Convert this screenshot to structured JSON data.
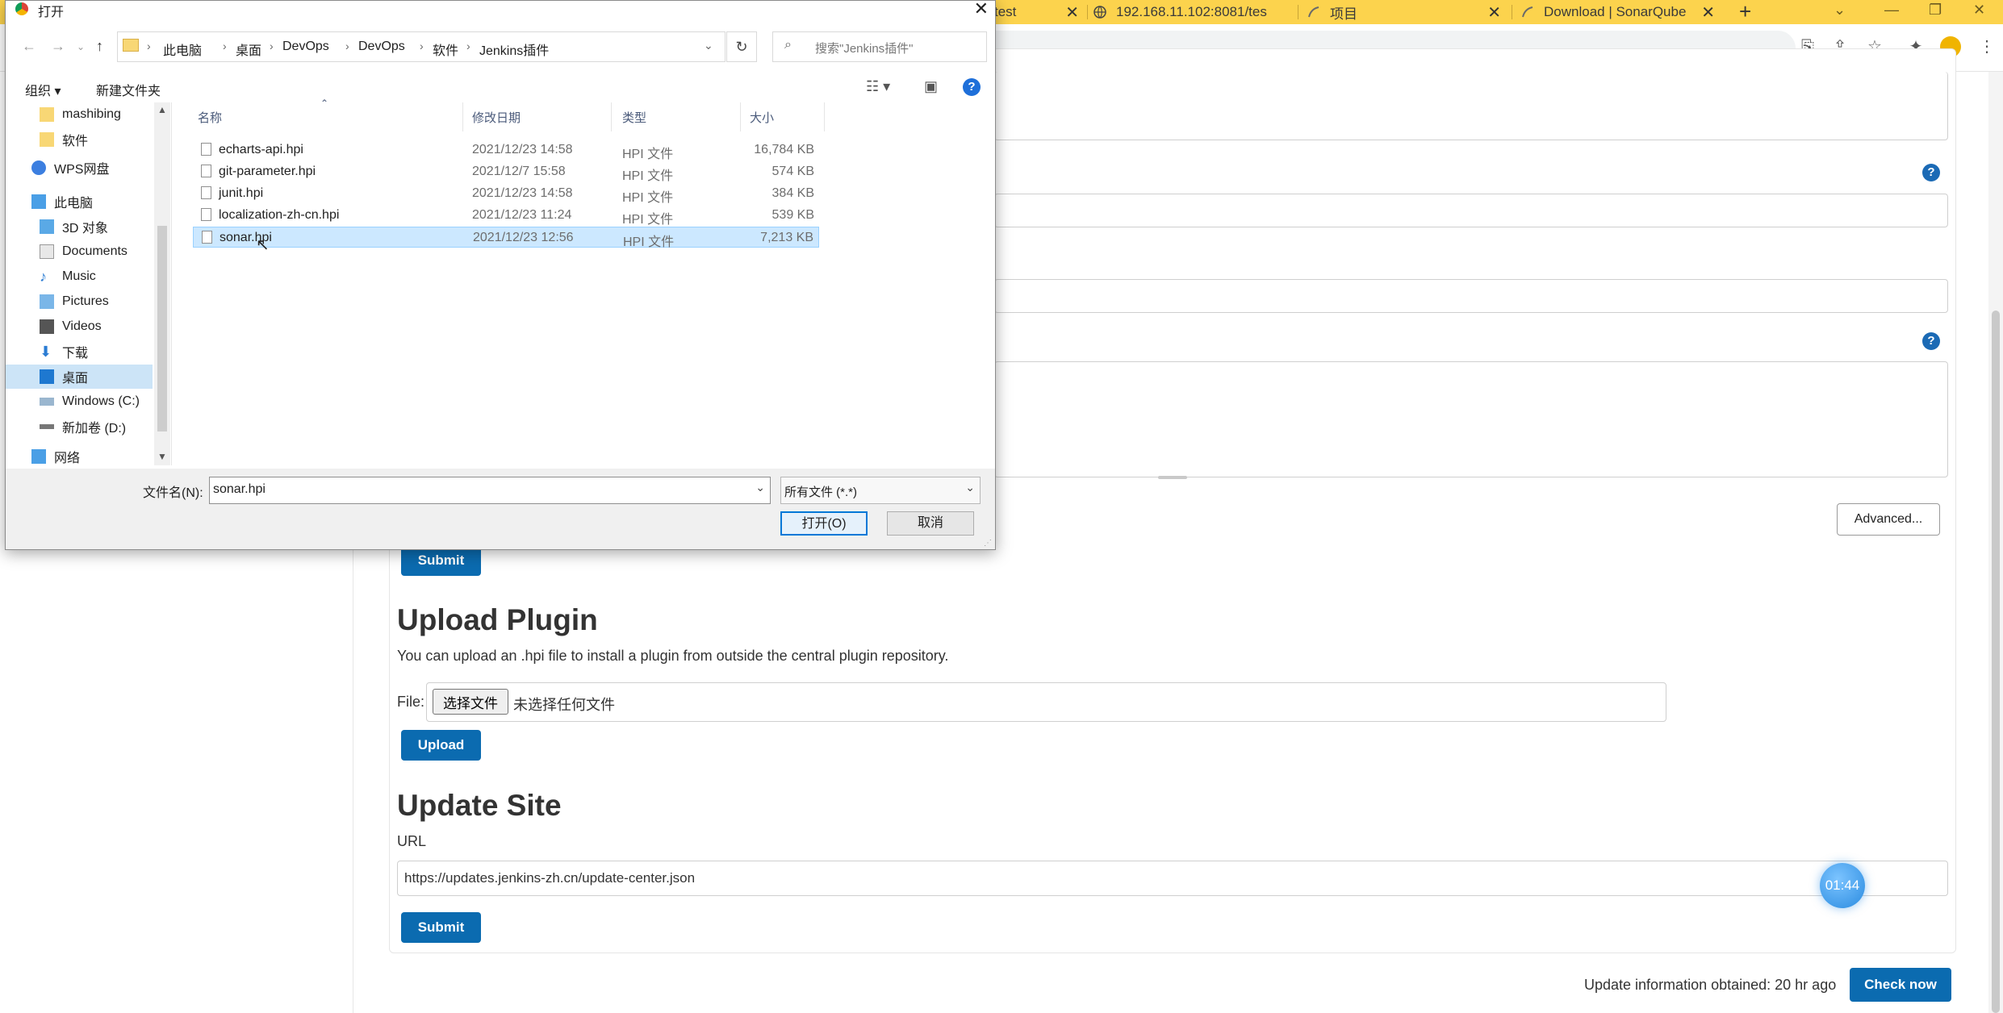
{
  "browser": {
    "tabs": [
      {
        "title": "test"
      },
      {
        "title": "192.168.11.102:8081/tes"
      },
      {
        "title": "项目"
      },
      {
        "title": "Download | SonarQube"
      }
    ],
    "new_tab": "+",
    "colors": {
      "tabstrip": "#fcd34d",
      "accent": "#0b6bb0"
    }
  },
  "page": {
    "advanced_button": "Advanced...",
    "submit_label": "Submit",
    "upload_plugin": {
      "title": "Upload Plugin",
      "description": "You can upload an .hpi file to install a plugin from outside the central plugin repository.",
      "file_label": "File:",
      "choose_button": "选择文件",
      "no_file_text": "未选择任何文件",
      "upload_button": "Upload"
    },
    "update_site": {
      "title": "Update Site",
      "url_label": "URL",
      "url_value": "https://updates.jenkins-zh.cn/update-center.json",
      "submit_button": "Submit"
    },
    "footer": {
      "update_info": "Update information obtained: 20 hr ago",
      "check_now": "Check now"
    },
    "timer": "01:44"
  },
  "dialog": {
    "title": "打开",
    "breadcrumbs": [
      "此电脑",
      "桌面",
      "DevOps",
      "DevOps",
      "软件",
      "Jenkins插件"
    ],
    "search_placeholder": "搜索\"Jenkins插件\"",
    "organize": "组织 ▾",
    "new_folder": "新建文件夹",
    "nav_items": [
      {
        "label": "mashibing",
        "icon": "folder-icon"
      },
      {
        "label": "软件",
        "icon": "folder-icon"
      },
      {
        "label": "WPS网盘",
        "icon": "cloud-icon"
      },
      {
        "label": "此电脑",
        "icon": "computer-icon"
      },
      {
        "label": "3D 对象",
        "icon": "cube-icon"
      },
      {
        "label": "Documents",
        "icon": "document-icon"
      },
      {
        "label": "Music",
        "icon": "music-icon"
      },
      {
        "label": "Pictures",
        "icon": "picture-icon"
      },
      {
        "label": "Videos",
        "icon": "video-icon"
      },
      {
        "label": "下载",
        "icon": "download-icon"
      },
      {
        "label": "桌面",
        "icon": "desktop-icon"
      },
      {
        "label": "Windows (C:)",
        "icon": "drive-icon"
      },
      {
        "label": "新加卷 (D:)",
        "icon": "drive-icon"
      },
      {
        "label": "网络",
        "icon": "network-icon"
      }
    ],
    "columns": [
      "名称",
      "修改日期",
      "类型",
      "大小"
    ],
    "files": [
      {
        "name": "echarts-api.hpi",
        "date": "2021/12/23 14:58",
        "type": "HPI 文件",
        "size": "16,784 KB"
      },
      {
        "name": "git-parameter.hpi",
        "date": "2021/12/7 15:58",
        "type": "HPI 文件",
        "size": "574 KB"
      },
      {
        "name": "junit.hpi",
        "date": "2021/12/23 14:58",
        "type": "HPI 文件",
        "size": "384 KB"
      },
      {
        "name": "localization-zh-cn.hpi",
        "date": "2021/12/23 11:24",
        "type": "HPI 文件",
        "size": "539 KB"
      },
      {
        "name": "sonar.hpi",
        "date": "2021/12/23 12:56",
        "type": "HPI 文件",
        "size": "7,213 KB"
      }
    ],
    "filename_label": "文件名(N):",
    "filename_value": "sonar.hpi",
    "filetype_value": "所有文件 (*.*)",
    "open_button": "打开(O)",
    "cancel_button": "取消"
  }
}
